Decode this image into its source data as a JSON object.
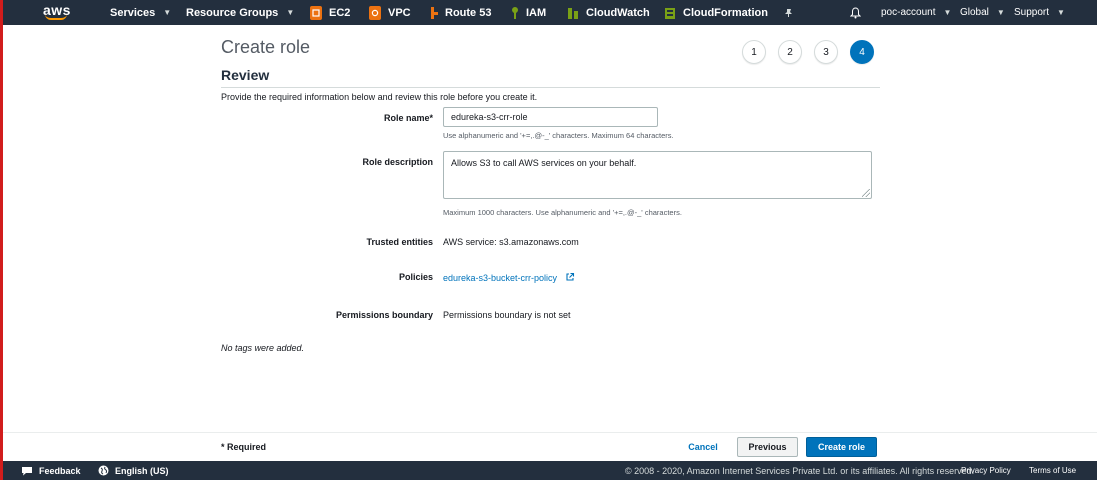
{
  "nav": {
    "logo": "aws",
    "services": "Services",
    "resource_groups": "Resource Groups",
    "pinned": [
      {
        "label": "EC2",
        "icon": "ec2-icon",
        "color": "#ec7211"
      },
      {
        "label": "VPC",
        "icon": "vpc-icon",
        "color": "#ec7211"
      },
      {
        "label": "Route 53",
        "icon": "route53-icon",
        "color": "#ec7211"
      },
      {
        "label": "IAM",
        "icon": "iam-icon",
        "color": "#7aa116"
      },
      {
        "label": "CloudWatch",
        "icon": "cloudwatch-icon",
        "color": "#7aa116"
      },
      {
        "label": "CloudFormation",
        "icon": "cloudformation-icon",
        "color": "#7aa116"
      }
    ],
    "account": "poc-account",
    "region": "Global",
    "support": "Support"
  },
  "page": {
    "title": "Create role",
    "steps": [
      "1",
      "2",
      "3",
      "4"
    ],
    "active_step": "4",
    "section_title": "Review",
    "intro": "Provide the required information below and review this role before you create it."
  },
  "form": {
    "role_name_label": "Role name*",
    "role_name_value": "edureka-s3-crr-role",
    "role_name_hint": "Use alphanumeric and '+=,.@-_' characters. Maximum 64 characters.",
    "role_description_label": "Role description",
    "role_description_value": "Allows S3 to call AWS services on your behalf.",
    "role_description_hint": "Maximum 1000 characters. Use alphanumeric and '+=,.@-_' characters.",
    "trusted_entities_label": "Trusted entities",
    "trusted_entities_value": "AWS service: s3.amazonaws.com",
    "policies_label": "Policies",
    "policies_value": "edureka-s3-bucket-crr-policy",
    "permissions_boundary_label": "Permissions boundary",
    "permissions_boundary_value": "Permissions boundary is not set",
    "no_tags": "No tags were added."
  },
  "actions": {
    "required": "* Required",
    "cancel": "Cancel",
    "previous": "Previous",
    "create": "Create role"
  },
  "footer": {
    "feedback": "Feedback",
    "language": "English (US)",
    "copyright": "© 2008 - 2020, Amazon Internet Services Private Ltd. or its affiliates. All rights reserved.",
    "privacy": "Privacy Policy",
    "terms": "Terms of Use"
  },
  "colors": {
    "nav_bg": "#232f3e",
    "primary": "#0073bb",
    "aws_orange": "#ff9900"
  }
}
